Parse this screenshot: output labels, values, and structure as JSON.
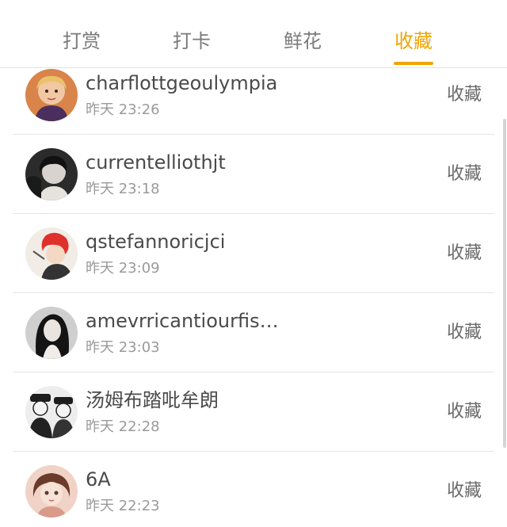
{
  "tabs": [
    {
      "label": "打赏",
      "active": false
    },
    {
      "label": "打卡",
      "active": false
    },
    {
      "label": "鲜花",
      "active": false
    },
    {
      "label": "收藏",
      "active": true
    }
  ],
  "accent_color": "#f0a500",
  "list": [
    {
      "name": "charflottgeoulympia",
      "time": "昨天 23:26",
      "action": "收藏"
    },
    {
      "name": "currentelliothjt",
      "time": "昨天 23:18",
      "action": "收藏"
    },
    {
      "name": "qstefannoricjci",
      "time": "昨天 23:09",
      "action": "收藏"
    },
    {
      "name": "amevrricantiourfis…",
      "time": "昨天 23:03",
      "action": "收藏"
    },
    {
      "name": "汤姆布踏吡牟朗",
      "time": "昨天 22:28",
      "action": "收藏"
    },
    {
      "name": "6A",
      "time": "昨天 22:23",
      "action": "收藏"
    }
  ]
}
